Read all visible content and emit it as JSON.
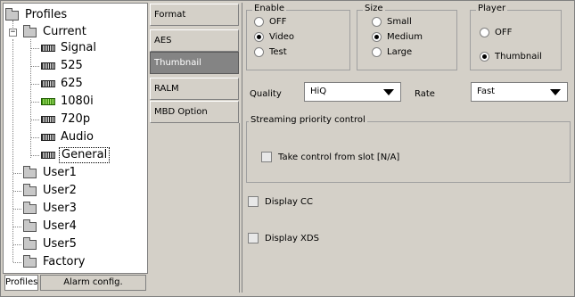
{
  "tree": {
    "root": "Profiles",
    "current": "Current",
    "current_children": [
      "Signal",
      "525",
      "625",
      "1080i",
      "720p",
      "Audio",
      "General"
    ],
    "users": [
      "User1",
      "User2",
      "User3",
      "User4",
      "User5",
      "Factory"
    ],
    "expander_symbol": "−",
    "selected": "General",
    "highlight_color": "#7fc93e"
  },
  "bottom_tabs": [
    "Profiles",
    "Alarm config."
  ],
  "categories": [
    "Format",
    "AES",
    "Thumbnail",
    "RALM",
    "MBD Option"
  ],
  "active_category": "Thumbnail",
  "enable": {
    "title": "Enable",
    "options": [
      "OFF",
      "Video",
      "Test"
    ],
    "selected": "Video"
  },
  "size": {
    "title": "Size",
    "options": [
      "Small",
      "Medium",
      "Large"
    ],
    "selected": "Medium"
  },
  "player": {
    "title": "Player",
    "options": [
      "OFF",
      "Thumbnail"
    ],
    "selected": "Thumbnail"
  },
  "quality": {
    "label": "Quality",
    "value": "HiQ"
  },
  "rate": {
    "label": "Rate",
    "value": "Fast"
  },
  "streaming": {
    "title": "Streaming priority control",
    "checkbox_label": "Take control from slot [N/A]",
    "checked": false
  },
  "display_cc": {
    "label": "Display CC",
    "checked": false
  },
  "display_xds": {
    "label": "Display XDS",
    "checked": false
  }
}
